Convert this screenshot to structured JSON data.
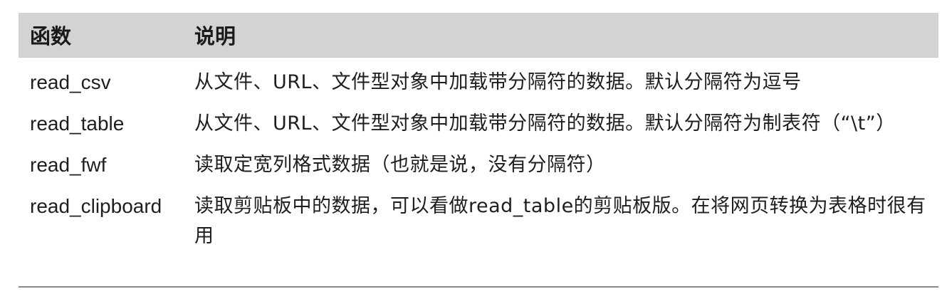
{
  "table": {
    "headers": {
      "function": "函数",
      "description": "说明"
    },
    "rows": [
      {
        "function": "read_csv",
        "description": "从文件、URL、文件型对象中加载带分隔符的数据。默认分隔符为逗号"
      },
      {
        "function": "read_table",
        "description": "从文件、URL、文件型对象中加载带分隔符的数据。默认分隔符为制表符（“\\t”）"
      },
      {
        "function": "read_fwf",
        "description": "读取定宽列格式数据（也就是说，没有分隔符）"
      },
      {
        "function": "read_clipboard",
        "description": "读取剪贴板中的数据，可以看做read_table的剪贴板版。在将网页转换为表格时很有用"
      }
    ]
  }
}
